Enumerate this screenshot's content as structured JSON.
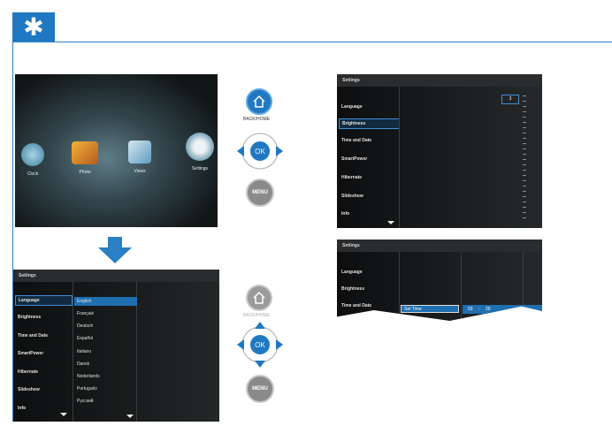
{
  "header": {
    "icon": "gear-icon",
    "accent": "#1f78c1"
  },
  "home_screen": {
    "icons": [
      {
        "label": "Clock",
        "icon": "clock-icon"
      },
      {
        "label": "Photo",
        "icon": "photo-icon"
      },
      {
        "label": "Views",
        "icon": "views-icon"
      },
      {
        "label": "Settings",
        "icon": "settings-icon"
      }
    ]
  },
  "controls": {
    "back_home": "BACK/HOME",
    "ok": "OK",
    "menu": "MENU"
  },
  "settings_lang": {
    "title": "Settings",
    "menu": [
      "Language",
      "Brightness",
      "Time and Date",
      "SmartPower",
      "Hibernate",
      "Slideshow",
      "Info"
    ],
    "languages": [
      "English",
      "Français",
      "Deutsch",
      "Español",
      "Italiano",
      "Dansk",
      "Nederlands",
      "Português",
      "Русский"
    ]
  },
  "settings_brightness": {
    "title": "Settings",
    "menu": [
      "Language",
      "Brightness",
      "Time and Date",
      "SmartPower",
      "Hibernate",
      "Slideshow",
      "Info"
    ],
    "value": "3"
  },
  "settings_time": {
    "title": "Settings",
    "menu": [
      "Language",
      "Brightness",
      "Time and Date"
    ],
    "set_time": "Set Time",
    "hour": "03",
    "minute": "20"
  }
}
